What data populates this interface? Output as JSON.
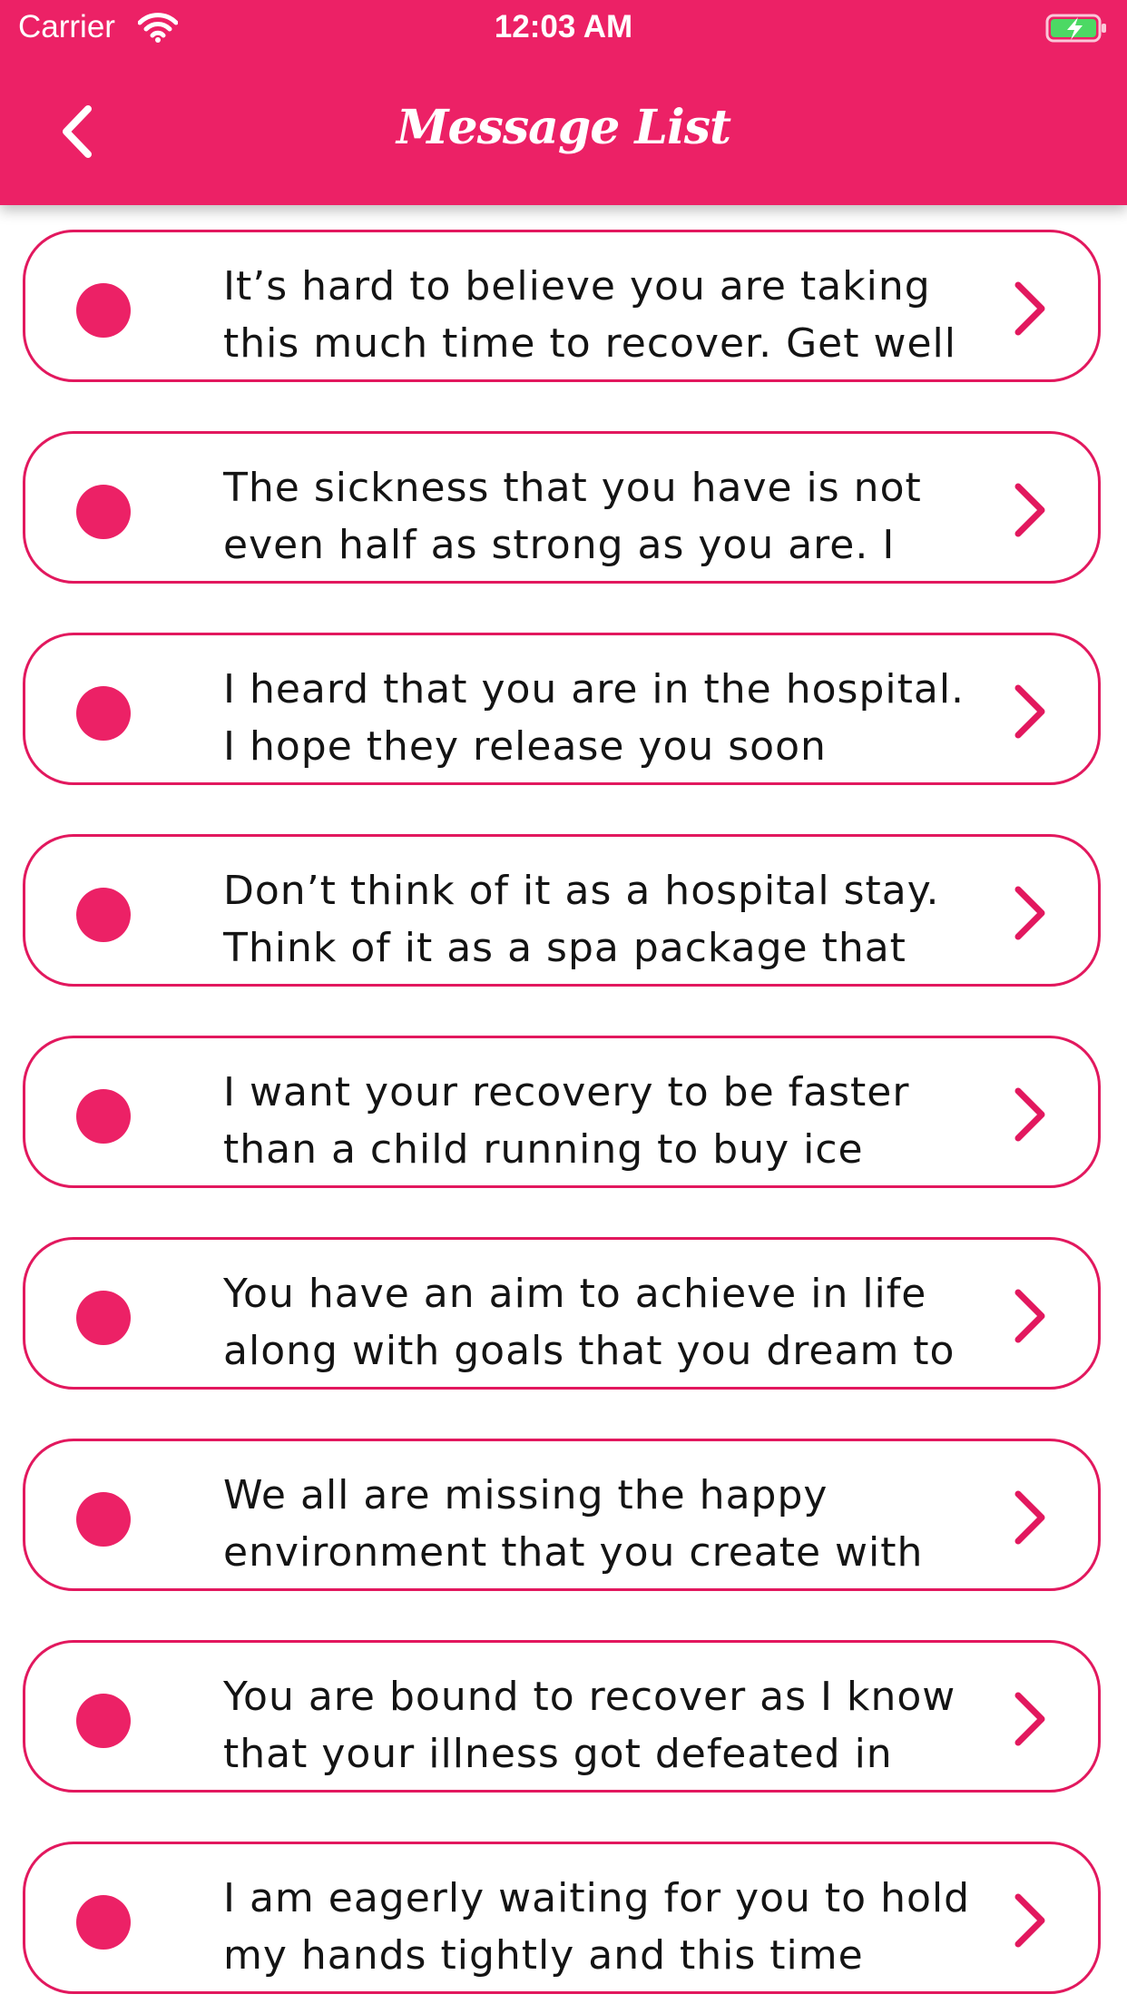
{
  "status_bar": {
    "carrier": "Carrier",
    "time": "12:03 AM",
    "wifi_icon": "wifi-icon",
    "battery_icon": "battery-charging-icon"
  },
  "header": {
    "title": "Message List",
    "back_icon": "chevron-left-icon",
    "background_color": "#EC2166"
  },
  "colors": {
    "accent": "#EC2166",
    "card_border": "#E2185E",
    "text": "#141414"
  },
  "messages": [
    {
      "text": "It’s hard to believe you are taking this much time to recover. Get well"
    },
    {
      "text": "The sickness that you have is not even half as strong as you are. I"
    },
    {
      "text": "I heard that you are in the hospital. I hope they release you soon"
    },
    {
      "text": "Don’t think of it as a hospital stay. Think of it as a spa package that"
    },
    {
      "text": "I want your recovery to be faster than a child running to buy ice"
    },
    {
      "text": "You have an aim to achieve in life along with goals that you dream to"
    },
    {
      "text": "We all are missing the happy environment that you create with"
    },
    {
      "text": "You are bound to recover as I know that your illness got defeated in"
    },
    {
      "text": "I am eagerly waiting for you to hold my hands tightly and this time"
    }
  ]
}
